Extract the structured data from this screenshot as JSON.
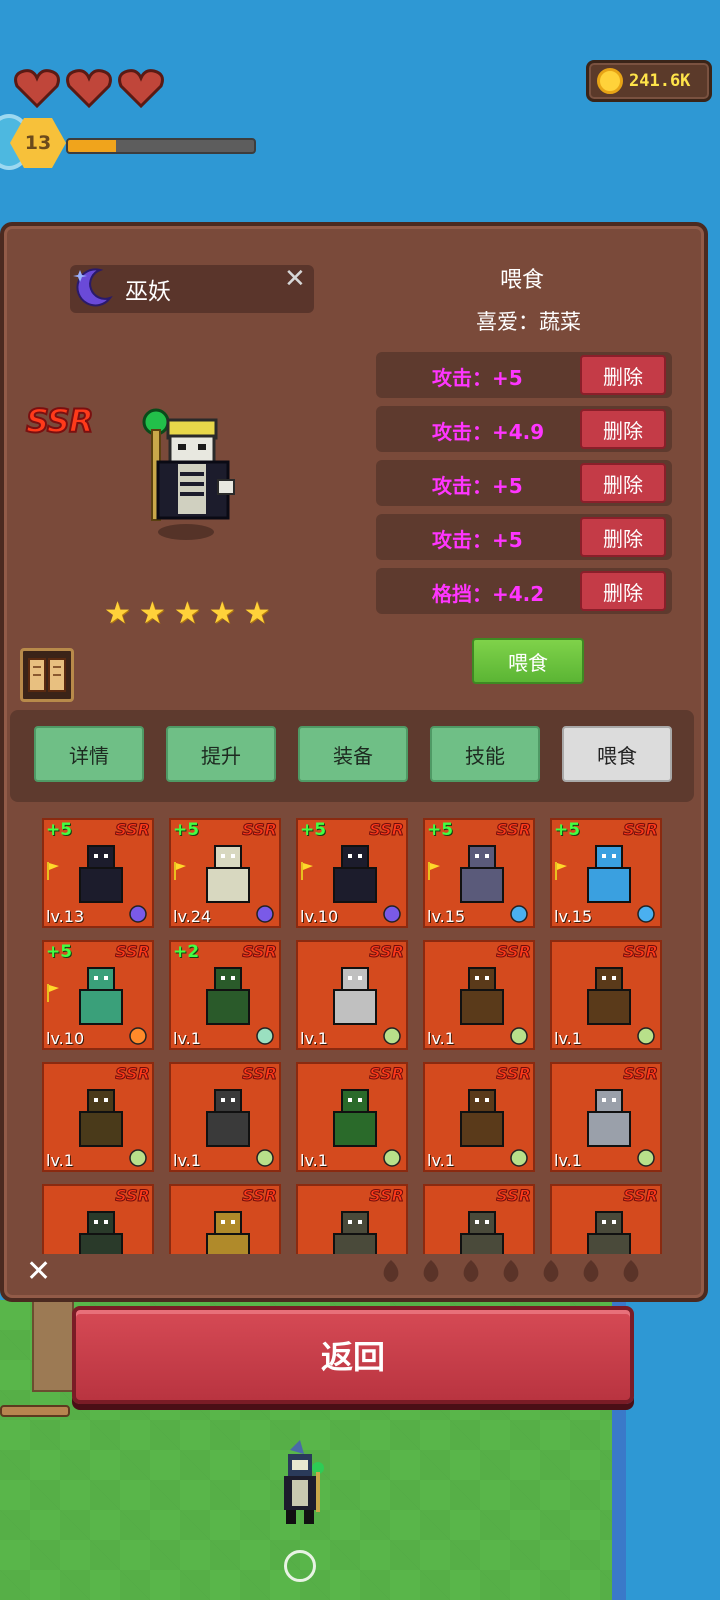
{
  "hud": {
    "hearts": 3,
    "level": "13",
    "xp_fraction": 0.26,
    "gold": "241.6K"
  },
  "hero": {
    "name": "巫妖",
    "rarity": "SSR",
    "stars": 5,
    "element_icon": "moon-icon"
  },
  "feed": {
    "title": "喂食",
    "likes": "喜爱：蔬菜",
    "stats": [
      {
        "text": "攻击：+5",
        "delete": "删除"
      },
      {
        "text": "攻击：+4.9",
        "delete": "删除"
      },
      {
        "text": "攻击：+5",
        "delete": "删除"
      },
      {
        "text": "攻击：+5",
        "delete": "删除"
      },
      {
        "text": "格挡：+4.2",
        "delete": "删除"
      }
    ],
    "feed_button": "喂食"
  },
  "tabs": [
    {
      "label": "详情"
    },
    {
      "label": "提升"
    },
    {
      "label": "装备"
    },
    {
      "label": "技能"
    },
    {
      "label": "喂食",
      "active": true
    }
  ],
  "cards": [
    {
      "plus": "+5",
      "ssr": "SSR",
      "lv": "lv.13",
      "elem": "moon",
      "flag": true,
      "color": "#1c1c2c"
    },
    {
      "plus": "+5",
      "ssr": "SSR",
      "lv": "lv.24",
      "elem": "moon",
      "flag": true,
      "color": "#d8d8c0"
    },
    {
      "plus": "+5",
      "ssr": "SSR",
      "lv": "lv.10",
      "elem": "moon",
      "flag": true,
      "color": "#1c1c2c"
    },
    {
      "plus": "+5",
      "ssr": "SSR",
      "lv": "lv.15",
      "elem": "water",
      "flag": true,
      "color": "#5a5a7a"
    },
    {
      "plus": "+5",
      "ssr": "SSR",
      "lv": "lv.15",
      "elem": "water",
      "flag": true,
      "color": "#3aa0e0"
    },
    {
      "plus": "+5",
      "ssr": "SSR",
      "lv": "lv.10",
      "elem": "sun",
      "flag": true,
      "color": "#3aa07a"
    },
    {
      "plus": "+2",
      "ssr": "SSR",
      "lv": "lv.1",
      "elem": "wind",
      "flag": false,
      "color": "#2a5a2a"
    },
    {
      "plus": "",
      "ssr": "SSR",
      "lv": "lv.1",
      "elem": "leaf",
      "flag": false,
      "color": "#c0c0c0"
    },
    {
      "plus": "",
      "ssr": "SSR",
      "lv": "lv.1",
      "elem": "leaf",
      "flag": false,
      "color": "#5a3a1a"
    },
    {
      "plus": "",
      "ssr": "SSR",
      "lv": "lv.1",
      "elem": "leaf",
      "flag": false,
      "color": "#5a3a1a"
    },
    {
      "plus": "",
      "ssr": "SSR",
      "lv": "lv.1",
      "elem": "leaf",
      "flag": false,
      "color": "#4a3a1a"
    },
    {
      "plus": "",
      "ssr": "SSR",
      "lv": "lv.1",
      "elem": "leaf",
      "flag": false,
      "color": "#3a3a3a"
    },
    {
      "plus": "",
      "ssr": "SSR",
      "lv": "lv.1",
      "elem": "leaf",
      "flag": false,
      "color": "#2a6a2a"
    },
    {
      "plus": "",
      "ssr": "SSR",
      "lv": "lv.1",
      "elem": "leaf",
      "flag": false,
      "color": "#5a3a1a"
    },
    {
      "plus": "",
      "ssr": "SSR",
      "lv": "lv.1",
      "elem": "leaf",
      "flag": false,
      "color": "#9aa0aa"
    },
    {
      "plus": "",
      "ssr": "SSR",
      "lv": "",
      "elem": "",
      "flag": false,
      "color": "#2a3a2a"
    },
    {
      "plus": "",
      "ssr": "SSR",
      "lv": "",
      "elem": "",
      "flag": false,
      "color": "#b08a2a"
    },
    {
      "plus": "",
      "ssr": "SSR",
      "lv": "",
      "elem": "",
      "flag": false,
      "color": "#4a4a3a"
    },
    {
      "plus": "",
      "ssr": "SSR",
      "lv": "",
      "elem": "",
      "flag": false,
      "color": "#4a4a3a"
    },
    {
      "plus": "",
      "ssr": "SSR",
      "lv": "",
      "elem": "",
      "flag": false,
      "color": "#4a4a3a"
    }
  ],
  "filters": [
    "fire-icon",
    "earth-icon",
    "water-drop-icon",
    "wind-icon",
    "flame-icon",
    "gear-burst-icon",
    "swirl-icon"
  ],
  "back_button": "返回",
  "colors": {
    "panel": "#7a4a3a",
    "card_bg": "#d44a1e",
    "stat_text": "#ff35ff",
    "delete_button": "#c43b47",
    "feed_button": "#5bb534",
    "tab": "#6fbf86",
    "back_button": "#c43d48"
  }
}
